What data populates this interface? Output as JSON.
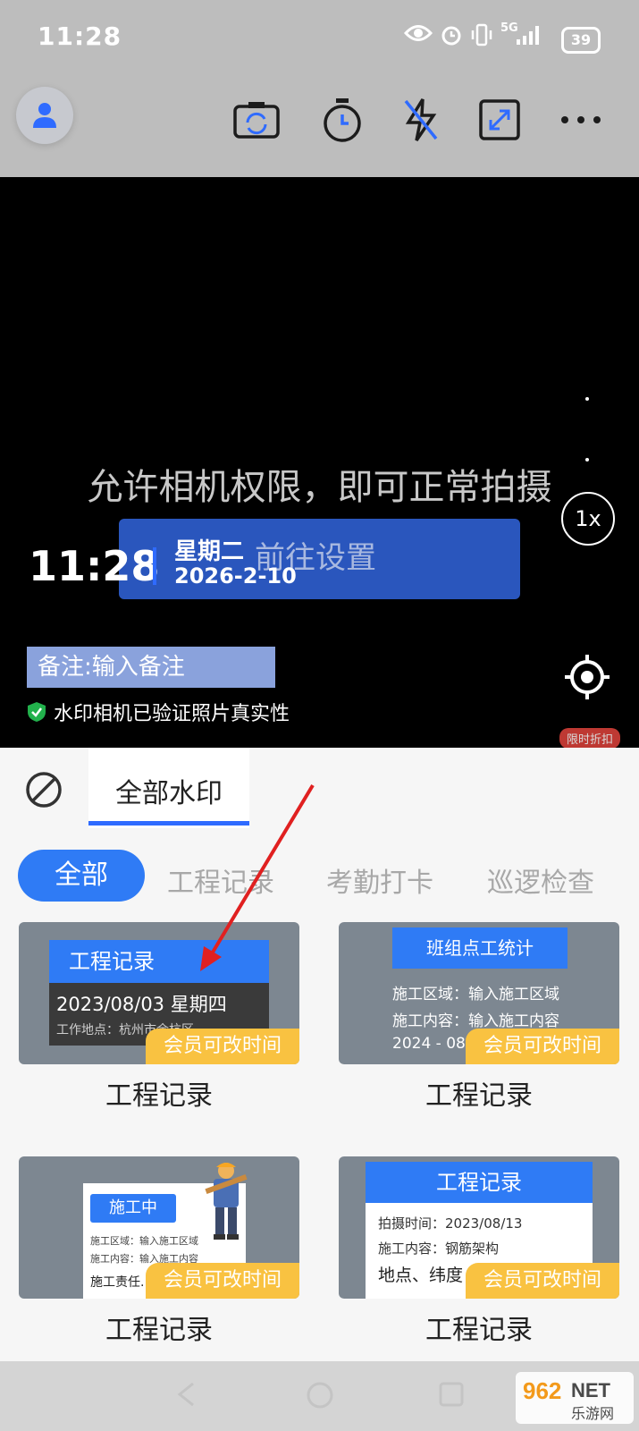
{
  "status": {
    "time": "11:28",
    "network": "5G",
    "battery": "39"
  },
  "toolbar": {
    "icons": [
      "user-icon",
      "flip-camera-icon",
      "timer-icon",
      "flash-off-icon",
      "expand-icon",
      "more-icon"
    ]
  },
  "camera": {
    "permission_text": "允许相机权限，即可正常拍摄",
    "settings_button": "前往设置",
    "watermark_time": "11:28",
    "watermark_day": "星期二",
    "watermark_date": "2026-2-10",
    "zoom": "1x",
    "remark": "备注:输入备注",
    "verified_text": "水印相机已验证照片真实性",
    "promo_badge": "限时折扣"
  },
  "sheet": {
    "tab_all_watermarks": "全部水印",
    "categories": [
      "全部",
      "工程记录",
      "考勤打卡",
      "巡逻检查"
    ],
    "member_tag": "会员可改时间",
    "cards": [
      {
        "label": "工程记录",
        "header": "工程记录",
        "date": "2023/08/03 星期四",
        "location": "工作地点：杭州市余杭区"
      },
      {
        "label": "工程记录",
        "header": "班组点工统计",
        "line1": "施工区域：输入施工区域",
        "line2": "施工内容：输入施工内容",
        "line3": "2024 - 08"
      },
      {
        "label": "工程记录",
        "header": "施工中",
        "line1": "施工区域：输入施工区域",
        "line2": "施工内容：输入施工内容",
        "line3": "施工责任..."
      },
      {
        "label": "工程记录",
        "header": "工程记录",
        "line1": "拍摄时间：2023/08/13",
        "line2": "施工内容：钢筋架构",
        "line3": "地点、纬度"
      }
    ]
  },
  "site_logo": {
    "text1": "962",
    "text2": "NET",
    "text3": "乐游网"
  },
  "colors": {
    "accent": "#2f7bf5",
    "member": "#f9c241",
    "camera_bg": "#000000"
  }
}
